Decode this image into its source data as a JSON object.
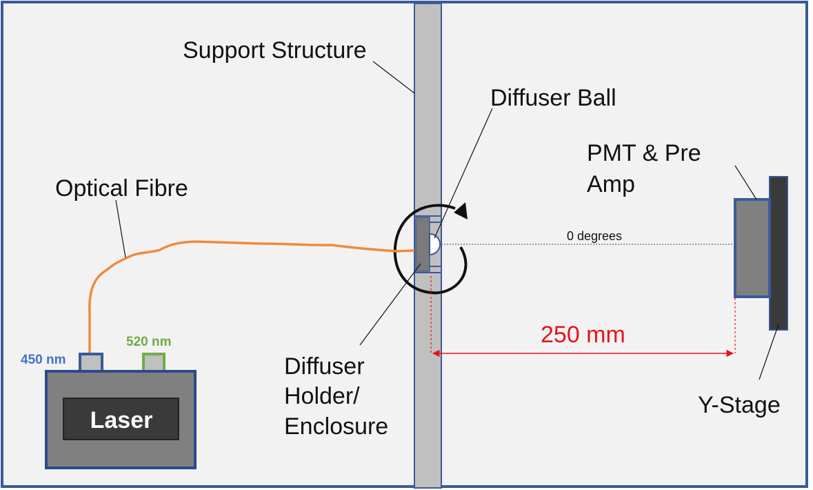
{
  "labels": {
    "support_structure": "Support Structure",
    "diffuser_ball": "Diffuser Ball",
    "pmt_line1": "PMT & Pre",
    "pmt_line2": "Amp",
    "optical_fibre": "Optical Fibre",
    "zero_degrees": "0 degrees",
    "distance": "250 mm",
    "holder_line1": "Diffuser",
    "holder_line2": "Holder/",
    "holder_line3": "Enclosure",
    "y_stage": "Y-Stage",
    "laser": "Laser",
    "wavelength_450": "450 nm",
    "wavelength_520": "520 nm"
  },
  "colors": {
    "frame": "#3a5a99",
    "panel": "#f2f2f2",
    "support": "#c0c0c0",
    "holder": "#7a7a7a",
    "pmt": "#808080",
    "stage": "#3a3a3a",
    "laser_body": "#808080",
    "laser_panel": "#3a3a3a",
    "fibre": "#ef8a3c",
    "wavelength_450": "#4472c4",
    "wavelength_520": "#70ad47",
    "dimension": "#e8141b"
  }
}
